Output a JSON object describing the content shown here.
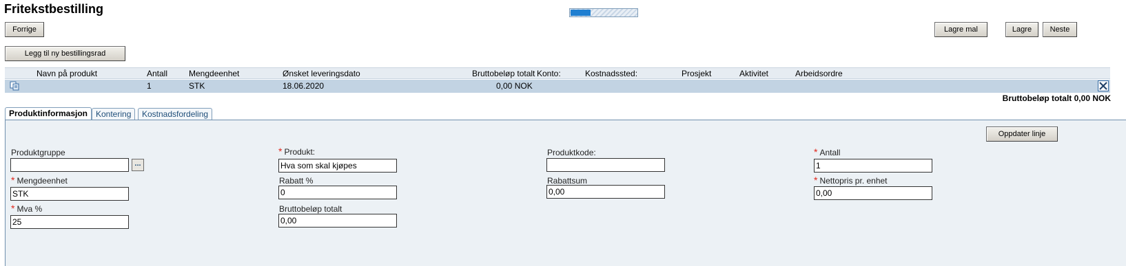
{
  "page": {
    "title": "Fritekstbestilling",
    "progress_fraction": 0.3
  },
  "toolbar": {
    "prev_label": "Forrige",
    "save_template_label": "Lagre mal",
    "save_label": "Lagre",
    "next_label": "Neste",
    "add_row_label": "Legg til ny bestillingsrad"
  },
  "grid": {
    "columns": {
      "product_name": "Navn på produkt",
      "quantity": "Antall",
      "unit": "Mengdeenhet",
      "delivery_date": "Ønsket leveringsdato",
      "gross_total": "Bruttobeløp totalt",
      "account": "Konto:",
      "cost_center": "Kostnadssted:",
      "project": "Prosjekt",
      "activity": "Aktivitet",
      "work_order": "Arbeidsordre"
    },
    "row": {
      "product_name": "",
      "quantity": "1",
      "unit": "STK",
      "delivery_date": "18.06.2020",
      "gross_total": "0,00 NOK"
    },
    "total_line": "Bruttobeløp totalt 0,00 NOK"
  },
  "tabs": [
    "Produktinformasjon",
    "Kontering",
    "Kostnadsfordeling"
  ],
  "form": {
    "update_line_label": "Oppdater linje",
    "product_group": {
      "label": "Produktgruppe",
      "value": "",
      "browse": "..."
    },
    "product": {
      "label": "Produkt:",
      "value": "Hva som skal kjøpes",
      "required": "*"
    },
    "product_code": {
      "label": "Produktkode:",
      "value": ""
    },
    "quantity": {
      "label": "Antall",
      "value": "1",
      "required": "*"
    },
    "unit": {
      "label": "Mengdeenhet",
      "value": "STK",
      "required": "*"
    },
    "discount_pct": {
      "label": "Rabatt %",
      "value": "0"
    },
    "discount_sum": {
      "label": "Rabattsum",
      "value": "0,00"
    },
    "net_price": {
      "label": "Nettopris pr. enhet",
      "value": "0,00",
      "required": "*"
    },
    "vat_pct": {
      "label": "Mva %",
      "value": "25",
      "required": "*"
    },
    "gross_total": {
      "label": "Bruttobeløp totalt",
      "value": "0,00"
    }
  },
  "colors": {
    "accent": "#1f7fd1",
    "row_selected": "#c2d3e3",
    "panel_bg": "#ecf1f5",
    "required": "#e0261b"
  }
}
